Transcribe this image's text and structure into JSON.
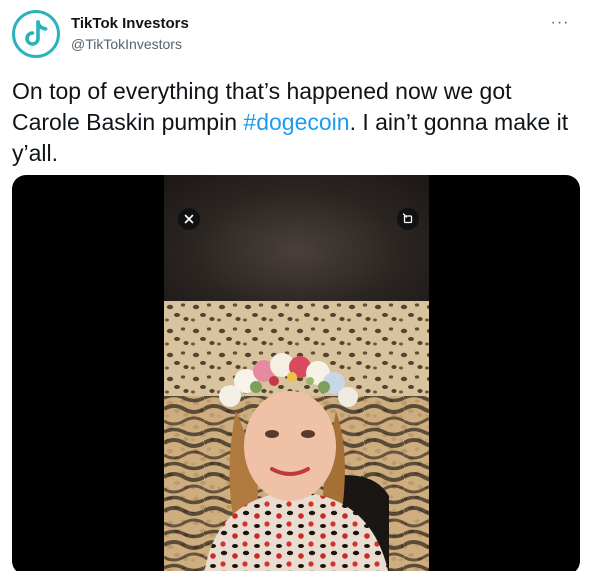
{
  "author": {
    "name": "TikTok Investors",
    "handle": "@TikTokInvestors",
    "avatar_icon": "tiktok-logo-icon",
    "avatar_ring_color": "#2bb3bb"
  },
  "tweet": {
    "text_before": "On top of everything that’s happened now we got Carole Baskin pumpin ",
    "hashtag": "#dogecoin",
    "text_after": ". I ain’t gonna make it y’all."
  },
  "more_menu": {
    "icon": "more-horizontal-icon",
    "glyph": "···"
  },
  "video": {
    "close_icon": "close-icon",
    "expand_icon": "expand-icon"
  },
  "colors": {
    "link": "#1d9bf0",
    "secondary_text": "#536471",
    "primary_text": "#0f1419"
  }
}
